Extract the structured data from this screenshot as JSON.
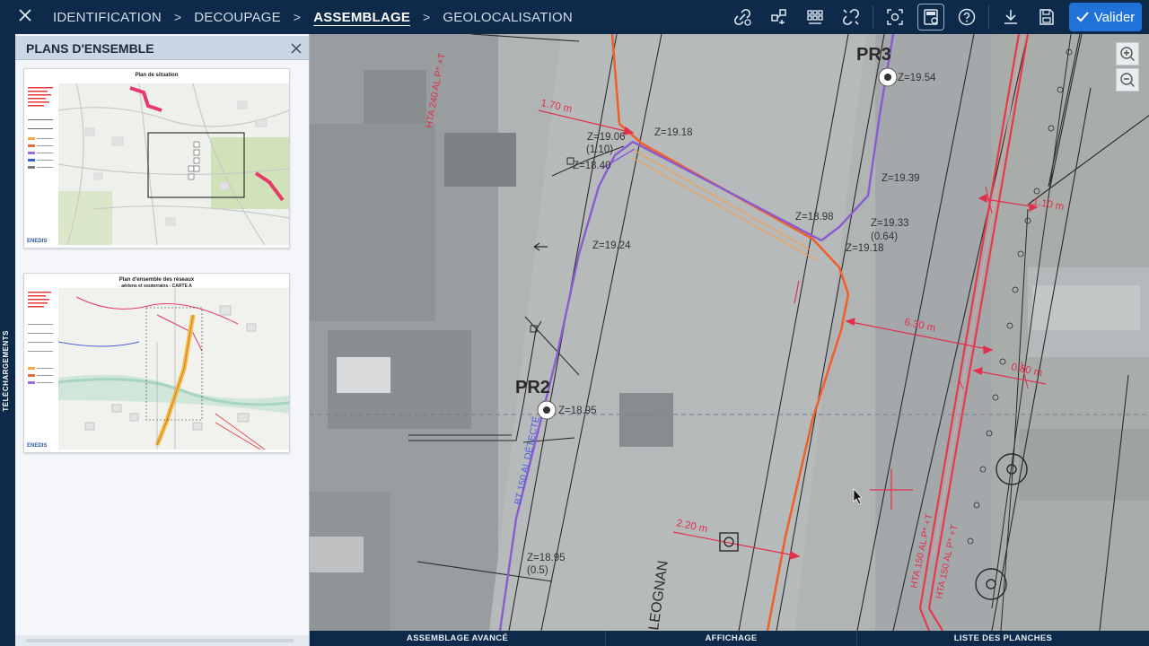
{
  "topbar": {
    "steps": [
      {
        "label": "IDENTIFICATION",
        "active": false
      },
      {
        "label": "DECOUPAGE",
        "active": false
      },
      {
        "label": "ASSEMBLAGE",
        "active": true
      },
      {
        "label": "GEOLOCALISATION",
        "active": false
      }
    ],
    "separator": ">",
    "validate_label": "Valider",
    "colors": {
      "bar": "#0d2a4a",
      "validate": "#1f73d8"
    }
  },
  "left_strip": {
    "label": "TÉLÉCHARGEMENTS"
  },
  "panel": {
    "title": "PLANS D'ENSEMBLE",
    "thumbnails": [
      {
        "title": "Plan de situation",
        "subtitle": "",
        "logo": "ENEDIS"
      },
      {
        "title": "Plan d'ensemble des réseaux",
        "subtitle": "aériens et souterrains - CARTE A",
        "logo": "ENEDIS"
      }
    ]
  },
  "map": {
    "labels": {
      "pr3": "PR3",
      "pr2": "PR2",
      "z1954": "Z=19.54",
      "z1918a": "Z=19.18",
      "z1906": "Z=19.06",
      "p110": "(1.10)",
      "z1840": "Z=18.40",
      "z1939": "Z=19.39",
      "z1898": "Z=18.98",
      "z1933": "Z=19.33",
      "p064": "(0.64)",
      "z1918b": "Z=19.18",
      "z1924": "Z=19.24",
      "z1895a": "Z=18.95",
      "z1895b": "Z=18.95",
      "p05": "(0.5)",
      "d170": "1.70 m",
      "d110": "1.10 m",
      "d630": "6.30 m",
      "d080": "0.80 m",
      "d220": "2.20 m",
      "hta240": "HTA 240 AL P* +T",
      "hta150a": "HTA 150 AL P* +T",
      "hta150b": "HTA 150 AL P* +T",
      "bt150": "BT 150 AL DÉTECTÉ",
      "street": "LEOGNAN"
    },
    "colors": {
      "hta": "#e8384a",
      "bt": "#8a5bd0",
      "route": "#f0602a",
      "dim": "#e0304a"
    }
  },
  "bottombar": {
    "items": [
      "ASSEMBLAGE AVANCÉ",
      "AFFICHAGE",
      "LISTE DES PLANCHES"
    ]
  }
}
